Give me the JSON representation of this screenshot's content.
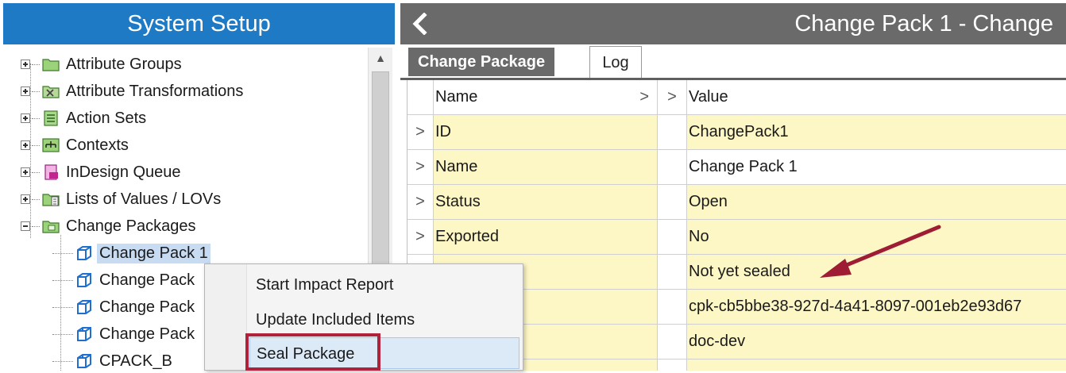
{
  "left_panel": {
    "title": "System Setup",
    "tree": [
      {
        "label": "Attribute Groups",
        "icon": "folder-icon",
        "expander": "plus"
      },
      {
        "label": "Attribute Transformations",
        "icon": "transformation-icon",
        "expander": "plus"
      },
      {
        "label": "Action Sets",
        "icon": "action-set-icon",
        "expander": "plus"
      },
      {
        "label": "Contexts",
        "icon": "context-icon",
        "expander": "plus"
      },
      {
        "label": "InDesign Queue",
        "icon": "indesign-icon",
        "expander": "plus"
      },
      {
        "label": "Lists of Values / LOVs",
        "icon": "lov-icon",
        "expander": "plus"
      },
      {
        "label": "Change Packages",
        "icon": "package-folder-icon",
        "expander": "minus"
      },
      {
        "label": "Change Pack 1",
        "icon": "change-pack-icon",
        "selected": true
      },
      {
        "label": "Change Pack",
        "icon": "change-pack-icon"
      },
      {
        "label": "Change Pack",
        "icon": "change-pack-icon"
      },
      {
        "label": "Change Pack",
        "icon": "sealed-pack-icon"
      },
      {
        "label": "CPACK_B",
        "icon": "sealed-pack-icon"
      }
    ]
  },
  "right_panel": {
    "title": "Change Pack 1 - Change",
    "tabs": [
      {
        "label": "Change Package",
        "active": true
      },
      {
        "label": "Log",
        "active": false
      }
    ],
    "grid": {
      "headers": {
        "name": "Name",
        "value": "Value"
      },
      "rows": [
        {
          "name": "ID",
          "value": "ChangePack1",
          "yellow": true
        },
        {
          "name": "Name",
          "value": "Change Pack 1",
          "yellow": false
        },
        {
          "name": "Status",
          "value": "Open",
          "yellow": true
        },
        {
          "name": "Exported",
          "value": "No",
          "yellow": true
        },
        {
          "name": "",
          "value": "Not yet sealed",
          "yellow": true
        },
        {
          "name": "",
          "value": "cpk-cb5bbe38-927d-4a41-8097-001eb2e93d67",
          "yellow": true
        },
        {
          "name": "",
          "value": "doc-dev",
          "yellow": true
        },
        {
          "name": "",
          "value": "",
          "yellow": true
        }
      ]
    }
  },
  "context_menu": {
    "items": [
      {
        "label": "Start Impact Report"
      },
      {
        "label": "Update Included Items"
      },
      {
        "label": "Seal Package",
        "highlighted": true
      }
    ]
  },
  "colors": {
    "left_header": "#1f7ac5",
    "right_header": "#6a6a6a",
    "row_yellow": "#fdf7c5",
    "annotation_red": "#b0223c"
  }
}
